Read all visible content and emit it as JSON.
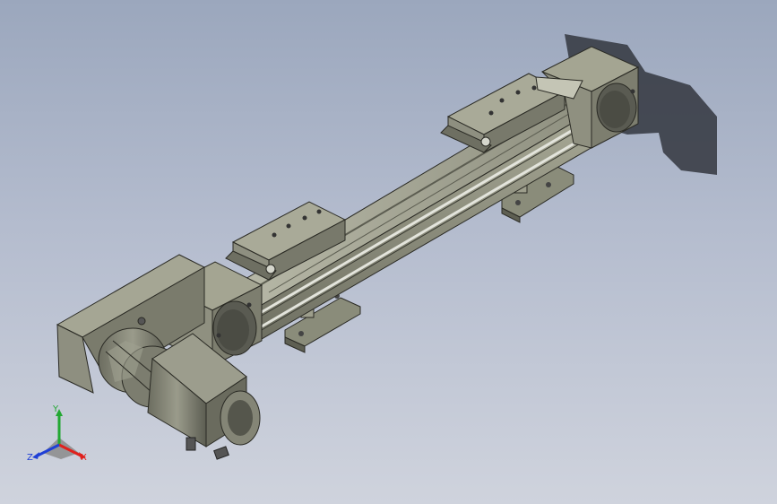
{
  "viewport": {
    "background_top": "#9ba7bd",
    "background_bottom": "#cfd3dd"
  },
  "model": {
    "body_color": "#8a8c7a",
    "body_dark": "#5e5f52",
    "body_light": "#b5b6a4",
    "rail_color": "#d7d9d0",
    "shadow_color": "#3c404a"
  },
  "triad": {
    "y_label": "Y",
    "x_label": "X",
    "z_label": "Z",
    "x_color": "#e0211d",
    "y_color": "#22a832",
    "z_color": "#1f3fd6"
  }
}
